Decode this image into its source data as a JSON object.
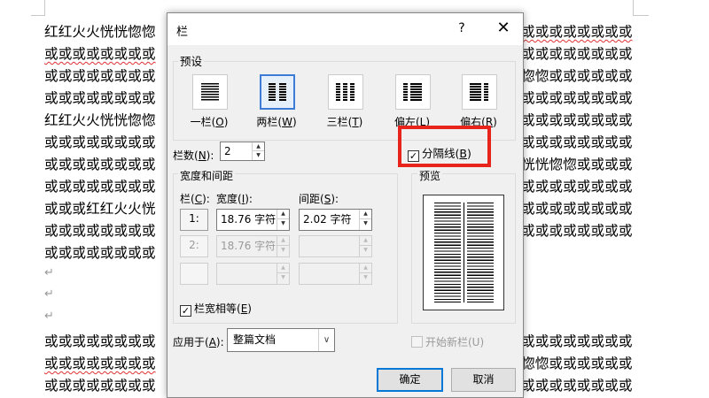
{
  "document": {
    "line1": "红红火火恍恍惚惚",
    "line_or": "或或或或或或或或",
    "line_or_short": "或或或或或或或",
    "line3_left": "或或或或或或或或",
    "line5_left": "红红火火恍恍惚惚",
    "line8_left": "或或或红红火火恍",
    "right_lines": [
      "或或或或或或或或",
      "或或或或或或或或",
      "惚惚或或或或或或",
      "或或或或或或或或",
      "或或或或或或或或",
      "或或或或或或或或",
      "恍恍惚惚或或或或",
      "或或或或或或或或",
      "或或或或或或或或",
      "或或或或或或或或"
    ],
    "bottom_right": [
      "或或或或或或或或",
      "惚惚或或或或或或",
      "或或或或或或或或"
    ],
    "para_mark": "↵"
  },
  "dialog": {
    "title": "栏",
    "help": "?",
    "close": "✕",
    "presets_label": "预设",
    "presets": [
      {
        "label": "一栏(",
        "key": "O",
        "tail": ")"
      },
      {
        "label": "两栏(",
        "key": "W",
        "tail": ")"
      },
      {
        "label": "三栏(",
        "key": "T",
        "tail": ")"
      },
      {
        "label": "偏左(",
        "key": "L",
        "tail": ")"
      },
      {
        "label": "偏右(",
        "key": "R",
        "tail": ")"
      }
    ],
    "selected_preset": "两栏",
    "num_cols_label": "栏数(",
    "num_cols_key": "N",
    "num_cols_tail": "):",
    "num_cols_value": "2",
    "separator_label": "分隔线(",
    "separator_key": "B",
    "separator_tail": ")",
    "separator_checked": "☑",
    "width_spacing_label": "宽度和间距",
    "col_label": "栏(",
    "col_key": "C",
    "col_tail": "):",
    "width_label": "宽度(",
    "width_key": "I",
    "width_tail": "):",
    "spacing_label": "间距(",
    "spacing_key": "S",
    "spacing_tail": "):",
    "rows": [
      {
        "num": "1:",
        "width": "18.76 字符",
        "spacing": "2.02 字符"
      },
      {
        "num": "2:",
        "width": "18.76 字符",
        "spacing": ""
      },
      {
        "num": "",
        "width": "",
        "spacing": ""
      }
    ],
    "equal_width_label": "栏宽相等(",
    "equal_width_key": "E",
    "equal_width_tail": ")",
    "check_mark": "✓",
    "preview_label": "预览",
    "apply_label": "应用于(",
    "apply_key": "A",
    "apply_tail": "):",
    "apply_value": "整篇文档",
    "new_col_label": "开始新栏(U)",
    "ok_label": "确定",
    "cancel_label": "取消",
    "spin_up": "▲",
    "spin_down": "▼",
    "dropdown_arrow": "∨"
  },
  "colors": {
    "highlight": "#e8231b",
    "selected_preset_border": "#3c7bd6",
    "ok_border": "#0078d7"
  }
}
